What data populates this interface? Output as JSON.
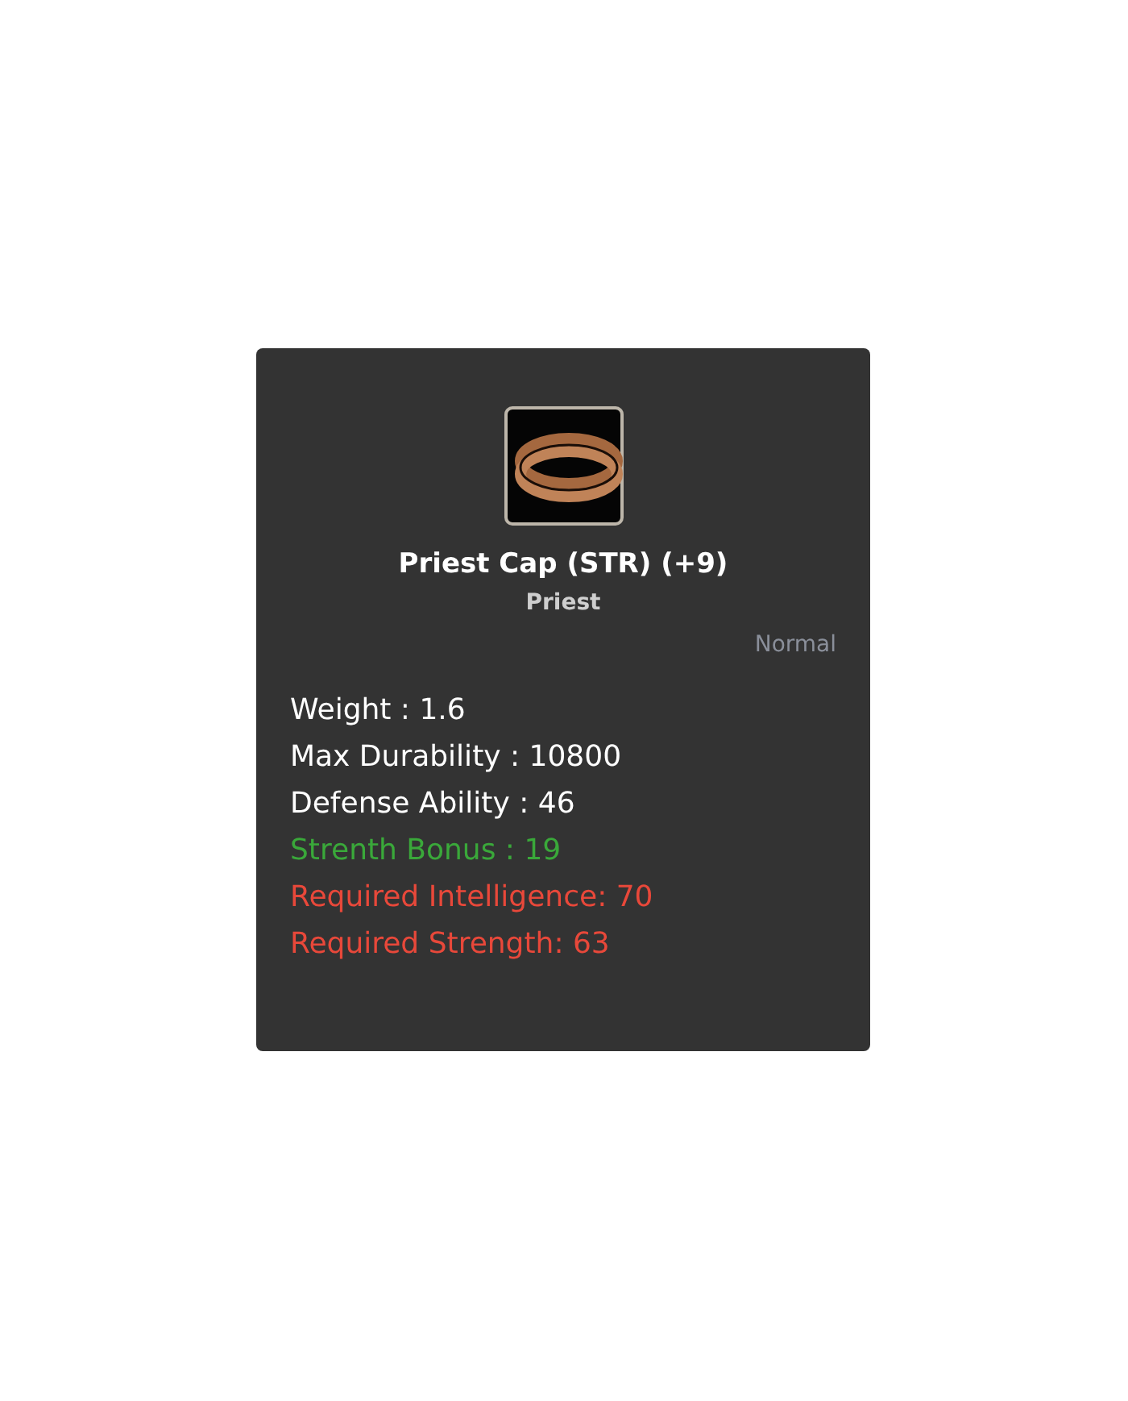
{
  "item": {
    "name": "Priest Cap (STR) (+9)",
    "class": "Priest",
    "grade": "Normal",
    "stats": [
      {
        "text": "Weight : 1.6",
        "color": "#ffffff"
      },
      {
        "text": "Max Durability : 10800",
        "color": "#ffffff"
      },
      {
        "text": "Defense Ability : 46",
        "color": "#ffffff"
      },
      {
        "text": "Strenth Bonus : 19",
        "color": "#3aa83a"
      },
      {
        "text": "Required Intelligence: 70",
        "color": "#e8483a"
      },
      {
        "text": "Required Strength: 63",
        "color": "#e8483a"
      }
    ]
  }
}
